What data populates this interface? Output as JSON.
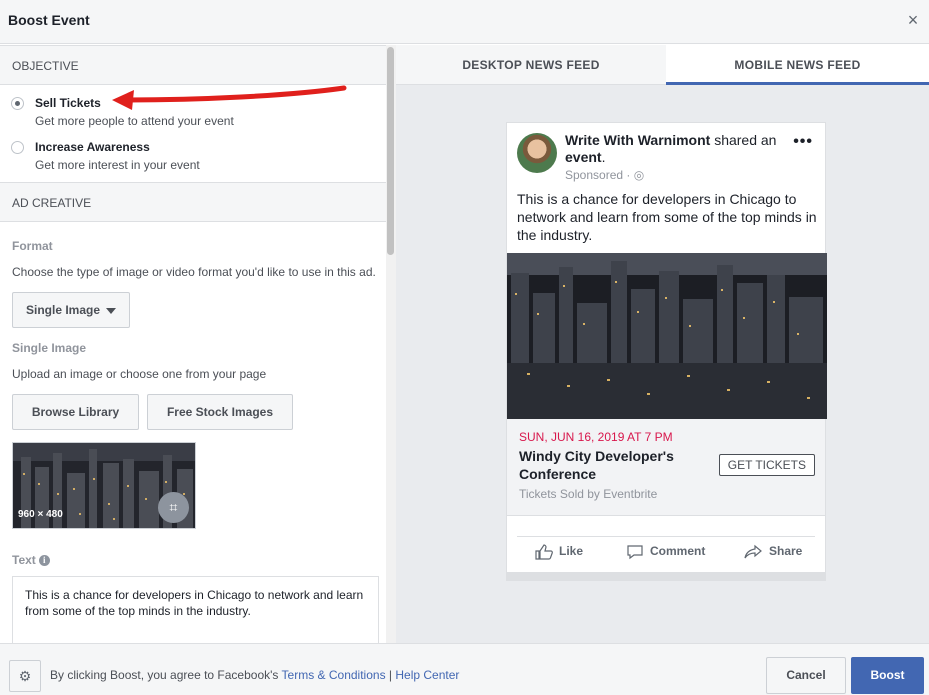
{
  "dialog": {
    "title": "Boost Event",
    "close_glyph": "×"
  },
  "objective": {
    "heading": "OBJECTIVE",
    "options": [
      {
        "label": "Sell Tickets",
        "sub": "Get more people to attend your event",
        "checked": true
      },
      {
        "label": "Increase Awareness",
        "sub": "Get more interest in your event",
        "checked": false
      }
    ]
  },
  "creative": {
    "heading": "AD CREATIVE",
    "format_label": "Format",
    "format_desc": "Choose the type of image or video format you'd like to use in this ad.",
    "format_value": "Single Image",
    "single_label": "Single Image",
    "single_desc": "Upload an image or choose one from your page",
    "browse_label": "Browse Library",
    "stock_label": "Free Stock Images",
    "image_dims": "960 × 480",
    "text_label": "Text",
    "text_value": "This is a chance for developers in Chicago to network and learn from some of the top minds in the industry."
  },
  "preview": {
    "tabs": [
      "DESKTOP NEWS FEED",
      "MOBILE NEWS FEED"
    ],
    "active_tab": 1,
    "author": "Write With Warnimont",
    "author_suffix": " shared an",
    "event_word": "event",
    "event_period": ".",
    "sponsored": "Sponsored",
    "sponsored_sep": " · ",
    "more_glyph": "•••",
    "post_text": "This is a chance for developers in Chicago to network and learn from some of the top minds in the industry.",
    "event_date": "SUN, JUN 16, 2019 AT 7 PM",
    "event_name": "Windy City Developer's Conference",
    "event_sub": "Tickets Sold by Eventbrite",
    "cta": "GET TICKETS",
    "actions": {
      "like": "Like",
      "comment": "Comment",
      "share": "Share"
    }
  },
  "footer": {
    "prefix": "By clicking Boost, you agree to Facebook's ",
    "terms": "Terms & Conditions",
    "sep": " | ",
    "help": "Help Center",
    "cancel": "Cancel",
    "boost": "Boost"
  },
  "colors": {
    "accent": "#4267b2",
    "date_red": "#d8174c",
    "arrow_red": "#e0201c"
  }
}
